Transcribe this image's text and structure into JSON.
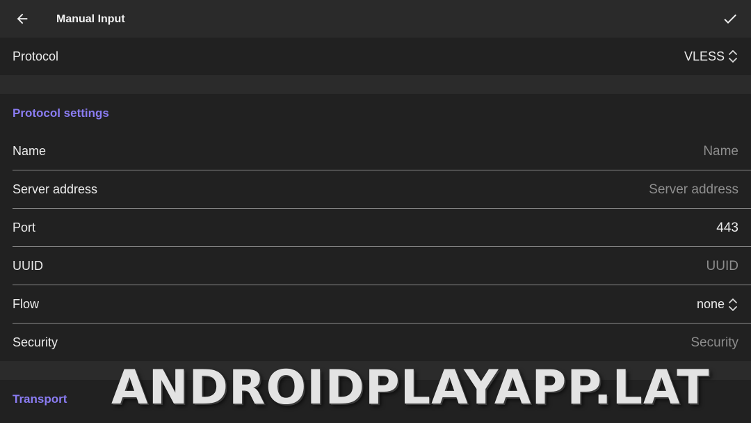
{
  "appbar": {
    "title": "Manual Input",
    "back_icon": "arrow-left-icon",
    "confirm_icon": "check-icon"
  },
  "protocol": {
    "label": "Protocol",
    "value": "VLESS"
  },
  "protocol_settings": {
    "header": "Protocol settings",
    "fields": [
      {
        "label": "Name",
        "value": "",
        "placeholder": "Name",
        "type": "input"
      },
      {
        "label": "Server address",
        "value": "",
        "placeholder": "Server address",
        "type": "input"
      },
      {
        "label": "Port",
        "value": "443",
        "placeholder": "",
        "type": "input"
      },
      {
        "label": "UUID",
        "value": "",
        "placeholder": "UUID",
        "type": "input"
      },
      {
        "label": "Flow",
        "value": "none",
        "placeholder": "",
        "type": "select"
      },
      {
        "label": "Security",
        "value": "",
        "placeholder": "Security",
        "type": "input"
      }
    ]
  },
  "transport": {
    "header": "Transport"
  },
  "watermark": "ANDROIDPLAYAPP.LAT",
  "colors": {
    "accent": "#8a7cf2",
    "background": "#1f1f1f",
    "appbar": "#2a2a2a",
    "placeholder": "#8e8e8e"
  }
}
